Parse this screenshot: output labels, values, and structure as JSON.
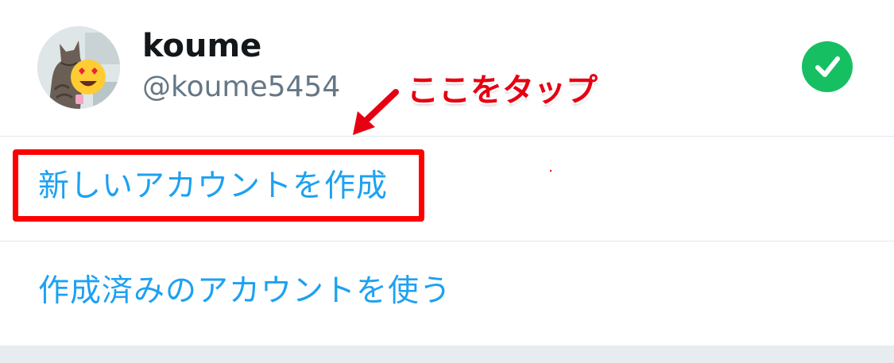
{
  "account": {
    "display_name": "koume",
    "handle": "@koume5454"
  },
  "menu": {
    "create_new_account": "新しいアカウントを作成",
    "use_existing_account": "作成済みのアカウントを使う"
  },
  "annotation": {
    "text": "ここをタップ"
  },
  "icons": {
    "avatar": "cat-avatar-with-heart-eyes-emoji",
    "selected": "checkmark-icon"
  },
  "colors": {
    "link": "#1da1f2",
    "check": "#17bf63",
    "highlight": "#ff0000",
    "annotation": "#e60012"
  }
}
